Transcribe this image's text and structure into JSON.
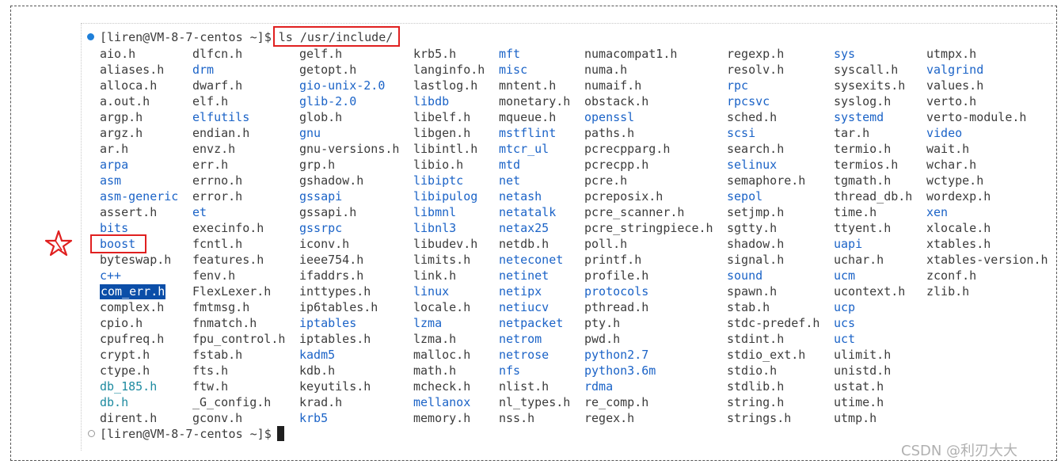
{
  "terminal": {
    "prompt": "[liren@VM-8-7-centos ~]$ ",
    "command": "ls /usr/include/",
    "columns": [
      [
        {
          "t": "aio.h",
          "k": "file"
        },
        {
          "t": "aliases.h",
          "k": "file"
        },
        {
          "t": "alloca.h",
          "k": "file"
        },
        {
          "t": "a.out.h",
          "k": "file"
        },
        {
          "t": "argp.h",
          "k": "file"
        },
        {
          "t": "argz.h",
          "k": "file"
        },
        {
          "t": "ar.h",
          "k": "file"
        },
        {
          "t": "arpa",
          "k": "dir"
        },
        {
          "t": "asm",
          "k": "dir"
        },
        {
          "t": "asm-generic",
          "k": "dir"
        },
        {
          "t": "assert.h",
          "k": "file"
        },
        {
          "t": "bits",
          "k": "dir"
        },
        {
          "t": "boost",
          "k": "dir"
        },
        {
          "t": "byteswap.h",
          "k": "file"
        },
        {
          "t": "c++",
          "k": "dir"
        },
        {
          "t": "com_err.h",
          "k": "sel"
        },
        {
          "t": "complex.h",
          "k": "file"
        },
        {
          "t": "cpio.h",
          "k": "file"
        },
        {
          "t": "cpufreq.h",
          "k": "file"
        },
        {
          "t": "crypt.h",
          "k": "file"
        },
        {
          "t": "ctype.h",
          "k": "file"
        },
        {
          "t": "db_185.h",
          "k": "link"
        },
        {
          "t": "db.h",
          "k": "link"
        },
        {
          "t": "dirent.h",
          "k": "file"
        }
      ],
      [
        {
          "t": "dlfcn.h",
          "k": "file"
        },
        {
          "t": "drm",
          "k": "dir"
        },
        {
          "t": "dwarf.h",
          "k": "file"
        },
        {
          "t": "elf.h",
          "k": "file"
        },
        {
          "t": "elfutils",
          "k": "dir"
        },
        {
          "t": "endian.h",
          "k": "file"
        },
        {
          "t": "envz.h",
          "k": "file"
        },
        {
          "t": "err.h",
          "k": "file"
        },
        {
          "t": "errno.h",
          "k": "file"
        },
        {
          "t": "error.h",
          "k": "file"
        },
        {
          "t": "et",
          "k": "dir"
        },
        {
          "t": "execinfo.h",
          "k": "file"
        },
        {
          "t": "fcntl.h",
          "k": "file"
        },
        {
          "t": "features.h",
          "k": "file"
        },
        {
          "t": "fenv.h",
          "k": "file"
        },
        {
          "t": "FlexLexer.h",
          "k": "file"
        },
        {
          "t": "fmtmsg.h",
          "k": "file"
        },
        {
          "t": "fnmatch.h",
          "k": "file"
        },
        {
          "t": "fpu_control.h",
          "k": "file"
        },
        {
          "t": "fstab.h",
          "k": "file"
        },
        {
          "t": "fts.h",
          "k": "file"
        },
        {
          "t": "ftw.h",
          "k": "file"
        },
        {
          "t": "_G_config.h",
          "k": "file"
        },
        {
          "t": "gconv.h",
          "k": "file"
        }
      ],
      [
        {
          "t": "gelf.h",
          "k": "file"
        },
        {
          "t": "getopt.h",
          "k": "file"
        },
        {
          "t": "gio-unix-2.0",
          "k": "dir"
        },
        {
          "t": "glib-2.0",
          "k": "dir"
        },
        {
          "t": "glob.h",
          "k": "file"
        },
        {
          "t": "gnu",
          "k": "dir"
        },
        {
          "t": "gnu-versions.h",
          "k": "file"
        },
        {
          "t": "grp.h",
          "k": "file"
        },
        {
          "t": "gshadow.h",
          "k": "file"
        },
        {
          "t": "gssapi",
          "k": "dir"
        },
        {
          "t": "gssapi.h",
          "k": "file"
        },
        {
          "t": "gssrpc",
          "k": "dir"
        },
        {
          "t": "iconv.h",
          "k": "file"
        },
        {
          "t": "ieee754.h",
          "k": "file"
        },
        {
          "t": "ifaddrs.h",
          "k": "file"
        },
        {
          "t": "inttypes.h",
          "k": "file"
        },
        {
          "t": "ip6tables.h",
          "k": "file"
        },
        {
          "t": "iptables",
          "k": "dir"
        },
        {
          "t": "iptables.h",
          "k": "file"
        },
        {
          "t": "kadm5",
          "k": "dir"
        },
        {
          "t": "kdb.h",
          "k": "file"
        },
        {
          "t": "keyutils.h",
          "k": "file"
        },
        {
          "t": "krad.h",
          "k": "file"
        },
        {
          "t": "krb5",
          "k": "dir"
        }
      ],
      [
        {
          "t": "krb5.h",
          "k": "file"
        },
        {
          "t": "langinfo.h",
          "k": "file"
        },
        {
          "t": "lastlog.h",
          "k": "file"
        },
        {
          "t": "libdb",
          "k": "dir"
        },
        {
          "t": "libelf.h",
          "k": "file"
        },
        {
          "t": "libgen.h",
          "k": "file"
        },
        {
          "t": "libintl.h",
          "k": "file"
        },
        {
          "t": "libio.h",
          "k": "file"
        },
        {
          "t": "libiptc",
          "k": "dir"
        },
        {
          "t": "libipulog",
          "k": "dir"
        },
        {
          "t": "libmnl",
          "k": "dir"
        },
        {
          "t": "libnl3",
          "k": "dir"
        },
        {
          "t": "libudev.h",
          "k": "file"
        },
        {
          "t": "limits.h",
          "k": "file"
        },
        {
          "t": "link.h",
          "k": "file"
        },
        {
          "t": "linux",
          "k": "dir"
        },
        {
          "t": "locale.h",
          "k": "file"
        },
        {
          "t": "lzma",
          "k": "dir"
        },
        {
          "t": "lzma.h",
          "k": "file"
        },
        {
          "t": "malloc.h",
          "k": "file"
        },
        {
          "t": "math.h",
          "k": "file"
        },
        {
          "t": "mcheck.h",
          "k": "file"
        },
        {
          "t": "mellanox",
          "k": "dir"
        },
        {
          "t": "memory.h",
          "k": "file"
        }
      ],
      [
        {
          "t": "mft",
          "k": "dir"
        },
        {
          "t": "misc",
          "k": "dir"
        },
        {
          "t": "mntent.h",
          "k": "file"
        },
        {
          "t": "monetary.h",
          "k": "file"
        },
        {
          "t": "mqueue.h",
          "k": "file"
        },
        {
          "t": "mstflint",
          "k": "dir"
        },
        {
          "t": "mtcr_ul",
          "k": "dir"
        },
        {
          "t": "mtd",
          "k": "dir"
        },
        {
          "t": "net",
          "k": "dir"
        },
        {
          "t": "netash",
          "k": "dir"
        },
        {
          "t": "netatalk",
          "k": "dir"
        },
        {
          "t": "netax25",
          "k": "dir"
        },
        {
          "t": "netdb.h",
          "k": "file"
        },
        {
          "t": "neteconet",
          "k": "dir"
        },
        {
          "t": "netinet",
          "k": "dir"
        },
        {
          "t": "netipx",
          "k": "dir"
        },
        {
          "t": "netiucv",
          "k": "dir"
        },
        {
          "t": "netpacket",
          "k": "dir"
        },
        {
          "t": "netrom",
          "k": "dir"
        },
        {
          "t": "netrose",
          "k": "dir"
        },
        {
          "t": "nfs",
          "k": "dir"
        },
        {
          "t": "nlist.h",
          "k": "file"
        },
        {
          "t": "nl_types.h",
          "k": "file"
        },
        {
          "t": "nss.h",
          "k": "file"
        }
      ],
      [
        {
          "t": "numacompat1.h",
          "k": "file"
        },
        {
          "t": "numa.h",
          "k": "file"
        },
        {
          "t": "numaif.h",
          "k": "file"
        },
        {
          "t": "obstack.h",
          "k": "file"
        },
        {
          "t": "openssl",
          "k": "dir"
        },
        {
          "t": "paths.h",
          "k": "file"
        },
        {
          "t": "pcrecpparg.h",
          "k": "file"
        },
        {
          "t": "pcrecpp.h",
          "k": "file"
        },
        {
          "t": "pcre.h",
          "k": "file"
        },
        {
          "t": "pcreposix.h",
          "k": "file"
        },
        {
          "t": "pcre_scanner.h",
          "k": "file"
        },
        {
          "t": "pcre_stringpiece.h",
          "k": "file"
        },
        {
          "t": "poll.h",
          "k": "file"
        },
        {
          "t": "printf.h",
          "k": "file"
        },
        {
          "t": "profile.h",
          "k": "file"
        },
        {
          "t": "protocols",
          "k": "dir"
        },
        {
          "t": "pthread.h",
          "k": "file"
        },
        {
          "t": "pty.h",
          "k": "file"
        },
        {
          "t": "pwd.h",
          "k": "file"
        },
        {
          "t": "python2.7",
          "k": "dir"
        },
        {
          "t": "python3.6m",
          "k": "dir"
        },
        {
          "t": "rdma",
          "k": "dir"
        },
        {
          "t": "re_comp.h",
          "k": "file"
        },
        {
          "t": "regex.h",
          "k": "file"
        }
      ],
      [
        {
          "t": "regexp.h",
          "k": "file"
        },
        {
          "t": "resolv.h",
          "k": "file"
        },
        {
          "t": "rpc",
          "k": "dir"
        },
        {
          "t": "rpcsvc",
          "k": "dir"
        },
        {
          "t": "sched.h",
          "k": "file"
        },
        {
          "t": "scsi",
          "k": "dir"
        },
        {
          "t": "search.h",
          "k": "file"
        },
        {
          "t": "selinux",
          "k": "dir"
        },
        {
          "t": "semaphore.h",
          "k": "file"
        },
        {
          "t": "sepol",
          "k": "dir"
        },
        {
          "t": "setjmp.h",
          "k": "file"
        },
        {
          "t": "sgtty.h",
          "k": "file"
        },
        {
          "t": "shadow.h",
          "k": "file"
        },
        {
          "t": "signal.h",
          "k": "file"
        },
        {
          "t": "sound",
          "k": "dir"
        },
        {
          "t": "spawn.h",
          "k": "file"
        },
        {
          "t": "stab.h",
          "k": "file"
        },
        {
          "t": "stdc-predef.h",
          "k": "file"
        },
        {
          "t": "stdint.h",
          "k": "file"
        },
        {
          "t": "stdio_ext.h",
          "k": "file"
        },
        {
          "t": "stdio.h",
          "k": "file"
        },
        {
          "t": "stdlib.h",
          "k": "file"
        },
        {
          "t": "string.h",
          "k": "file"
        },
        {
          "t": "strings.h",
          "k": "file"
        }
      ],
      [
        {
          "t": "sys",
          "k": "dir"
        },
        {
          "t": "syscall.h",
          "k": "file"
        },
        {
          "t": "sysexits.h",
          "k": "file"
        },
        {
          "t": "syslog.h",
          "k": "file"
        },
        {
          "t": "systemd",
          "k": "dir"
        },
        {
          "t": "tar.h",
          "k": "file"
        },
        {
          "t": "termio.h",
          "k": "file"
        },
        {
          "t": "termios.h",
          "k": "file"
        },
        {
          "t": "tgmath.h",
          "k": "file"
        },
        {
          "t": "thread_db.h",
          "k": "file"
        },
        {
          "t": "time.h",
          "k": "file"
        },
        {
          "t": "ttyent.h",
          "k": "file"
        },
        {
          "t": "uapi",
          "k": "dir"
        },
        {
          "t": "uchar.h",
          "k": "file"
        },
        {
          "t": "ucm",
          "k": "dir"
        },
        {
          "t": "ucontext.h",
          "k": "file"
        },
        {
          "t": "ucp",
          "k": "dir"
        },
        {
          "t": "ucs",
          "k": "dir"
        },
        {
          "t": "uct",
          "k": "dir"
        },
        {
          "t": "ulimit.h",
          "k": "file"
        },
        {
          "t": "unistd.h",
          "k": "file"
        },
        {
          "t": "ustat.h",
          "k": "file"
        },
        {
          "t": "utime.h",
          "k": "file"
        },
        {
          "t": "utmp.h",
          "k": "file"
        }
      ],
      [
        {
          "t": "utmpx.h",
          "k": "file"
        },
        {
          "t": "valgrind",
          "k": "dir"
        },
        {
          "t": "values.h",
          "k": "file"
        },
        {
          "t": "verto.h",
          "k": "file"
        },
        {
          "t": "verto-module.h",
          "k": "file"
        },
        {
          "t": "video",
          "k": "dir"
        },
        {
          "t": "wait.h",
          "k": "file"
        },
        {
          "t": "wchar.h",
          "k": "file"
        },
        {
          "t": "wctype.h",
          "k": "file"
        },
        {
          "t": "wordexp.h",
          "k": "file"
        },
        {
          "t": "xen",
          "k": "dir"
        },
        {
          "t": "xlocale.h",
          "k": "file"
        },
        {
          "t": "xtables.h",
          "k": "file"
        },
        {
          "t": "xtables-version.h",
          "k": "file"
        },
        {
          "t": "zconf.h",
          "k": "file"
        },
        {
          "t": "zlib.h",
          "k": "file"
        }
      ]
    ]
  },
  "watermark": "CSDN @利刃大大",
  "colors": {
    "directory": "#1b63c7",
    "symlink": "#1e8ba0",
    "file": "#3b3b3b",
    "selection": "#0b4ea8",
    "annotation": "#e02020"
  }
}
